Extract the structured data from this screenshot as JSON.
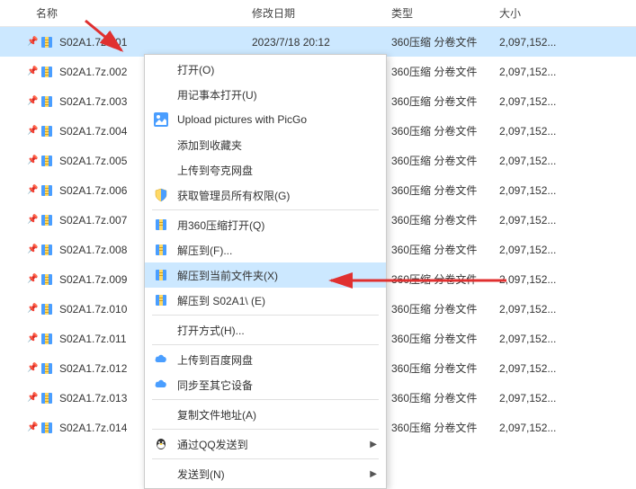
{
  "headers": {
    "name": "名称",
    "date": "修改日期",
    "type": "类型",
    "size": "大小"
  },
  "file_type": "360压缩 分卷文件",
  "file_size": "2,097,152...",
  "selected_date": "2023/7/18 20:12",
  "files": [
    {
      "name": "S02A1.7z.001",
      "selected": true
    },
    {
      "name": "S02A1.7z.002"
    },
    {
      "name": "S02A1.7z.003"
    },
    {
      "name": "S02A1.7z.004"
    },
    {
      "name": "S02A1.7z.005"
    },
    {
      "name": "S02A1.7z.006"
    },
    {
      "name": "S02A1.7z.007"
    },
    {
      "name": "S02A1.7z.008"
    },
    {
      "name": "S02A1.7z.009"
    },
    {
      "name": "S02A1.7z.010"
    },
    {
      "name": "S02A1.7z.011"
    },
    {
      "name": "S02A1.7z.012"
    },
    {
      "name": "S02A1.7z.013"
    },
    {
      "name": "S02A1.7z.014"
    }
  ],
  "menu": {
    "open": "打开(O)",
    "notepad": "用记事本打开(U)",
    "picgo": "Upload pictures with PicGo",
    "favorites": "添加到收藏夹",
    "kuake": "上传到夸克网盘",
    "admin": "获取管理员所有权限(G)",
    "open360": "用360压缩打开(Q)",
    "extractTo": "解压到(F)...",
    "extractHere": "解压到当前文件夹(X)",
    "extractFolder": "解压到 S02A1\\ (E)",
    "openWith": "打开方式(H)...",
    "baidu": "上传到百度网盘",
    "sync": "同步至其它设备",
    "copyAddr": "复制文件地址(A)",
    "qq": "通过QQ发送到",
    "sendTo": "发送到(N)"
  }
}
